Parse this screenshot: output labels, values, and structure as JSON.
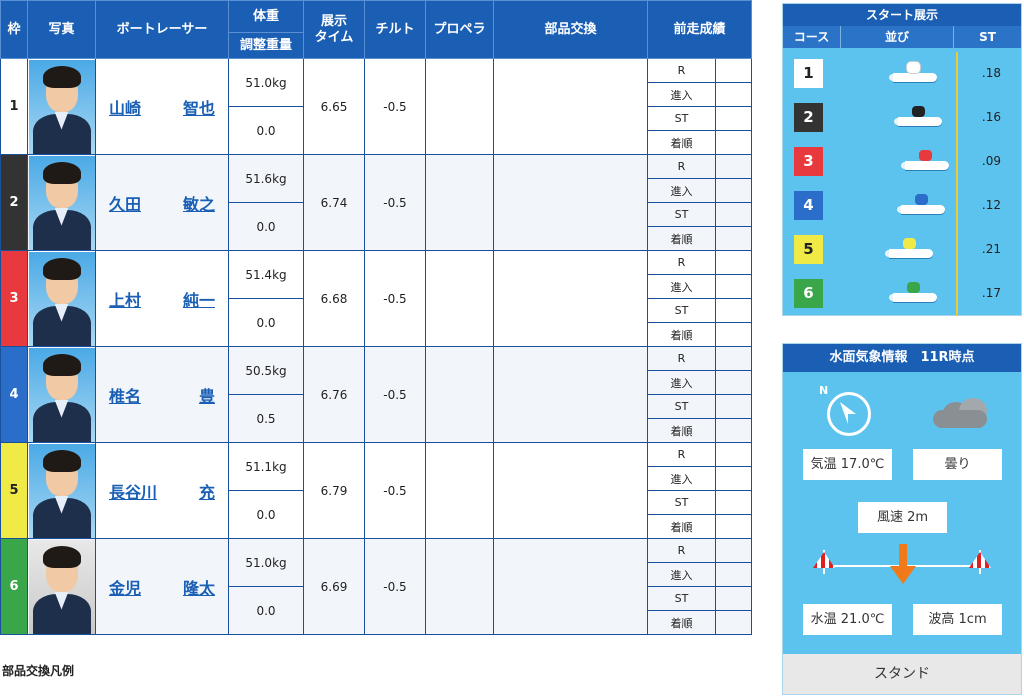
{
  "table": {
    "headers": {
      "waku": "枠",
      "photo": "写真",
      "racer": "ボートレーサー",
      "weight": "体重",
      "adjust": "調整重量",
      "time": "展示\nタイム",
      "tilt": "チルト",
      "propeller": "プロペラ",
      "parts": "部品交換",
      "prev": "前走成績"
    },
    "record_labels": [
      "R",
      "進入",
      "ST",
      "着順"
    ],
    "rows": [
      {
        "waku": "1",
        "color": "#ffffff",
        "text_color": "#222222",
        "last_name": "山崎",
        "first_name": "智也",
        "weight": "51.0kg",
        "adjust": "0.0",
        "time": "6.65",
        "tilt": "-0.5",
        "photo_bg": "blue"
      },
      {
        "waku": "2",
        "color": "#333333",
        "text_color": "#ffffff",
        "last_name": "久田",
        "first_name": "敏之",
        "weight": "51.6kg",
        "adjust": "0.0",
        "time": "6.74",
        "tilt": "-0.5",
        "photo_bg": "blue"
      },
      {
        "waku": "3",
        "color": "#e8393e",
        "text_color": "#ffffff",
        "last_name": "上村",
        "first_name": "純一",
        "weight": "51.4kg",
        "adjust": "0.0",
        "time": "6.68",
        "tilt": "-0.5",
        "photo_bg": "blue"
      },
      {
        "waku": "4",
        "color": "#2a6ec9",
        "text_color": "#ffffff",
        "last_name": "椎名",
        "first_name": "豊",
        "weight": "50.5kg",
        "adjust": "0.5",
        "time": "6.76",
        "tilt": "-0.5",
        "photo_bg": "blue"
      },
      {
        "waku": "5",
        "color": "#f0ea47",
        "text_color": "#222222",
        "last_name": "長谷川",
        "first_name": "充",
        "weight": "51.1kg",
        "adjust": "0.0",
        "time": "6.79",
        "tilt": "-0.5",
        "photo_bg": "blue"
      },
      {
        "waku": "6",
        "color": "#3aa64a",
        "text_color": "#ffffff",
        "last_name": "金児",
        "first_name": "隆太",
        "weight": "51.0kg",
        "adjust": "0.0",
        "time": "6.69",
        "tilt": "-0.5",
        "photo_bg": "gray"
      }
    ]
  },
  "legend_title": "部品交換凡例",
  "start": {
    "title": "スタート展示",
    "col_course": "コース",
    "col_order": "並び",
    "col_st": "ST",
    "lanes": [
      {
        "num": "1",
        "bg": "#ffffff",
        "fg": "#222222",
        "st": ".18",
        "rider": "#ffffff",
        "offset": 0.46
      },
      {
        "num": "2",
        "bg": "#333333",
        "fg": "#ffffff",
        "st": ".16",
        "rider": "#222222",
        "offset": 0.48
      },
      {
        "num": "3",
        "bg": "#e8393e",
        "fg": "#ffffff",
        "st": ".09",
        "rider": "#e8393e",
        "offset": 0.51
      },
      {
        "num": "4",
        "bg": "#2a6ec9",
        "fg": "#ffffff",
        "st": ".12",
        "rider": "#2a6ec9",
        "offset": 0.49
      },
      {
        "num": "5",
        "bg": "#f0ea47",
        "fg": "#222222",
        "st": ".21",
        "rider": "#f0ea47",
        "offset": 0.44
      },
      {
        "num": "6",
        "bg": "#3aa64a",
        "fg": "#ffffff",
        "st": ".17",
        "rider": "#3aa64a",
        "offset": 0.46
      }
    ]
  },
  "weather": {
    "title": "水面気象情報　11R時点",
    "compass_label": "N",
    "temp": "気温 17.0℃",
    "condition": "曇り",
    "wind": "風速 2m",
    "water_temp": "水温 21.0℃",
    "wave": "波高 1cm",
    "stand": "スタンド",
    "icons": {
      "compass": "compass-icon",
      "weather": "cloud-icon",
      "wind_direction": "wind-arrow-icon",
      "flag": "wind-flag-icon"
    }
  }
}
